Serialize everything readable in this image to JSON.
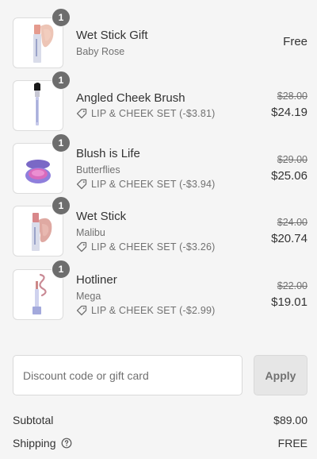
{
  "items": [
    {
      "quantity": "1",
      "name": "Wet Stick Gift",
      "variant": "Baby Rose",
      "discount": "",
      "original_price": "",
      "price": "Free",
      "image_icon": "lipstick-image"
    },
    {
      "quantity": "1",
      "name": "Angled Cheek Brush",
      "variant": "",
      "discount": "LIP & CHEEK SET (-$3.81)",
      "original_price": "$28.00",
      "price": "$24.19",
      "image_icon": "brush-image"
    },
    {
      "quantity": "1",
      "name": "Blush is Life",
      "variant": "Butterflies",
      "discount": "LIP & CHEEK SET (-$3.94)",
      "original_price": "$29.00",
      "price": "$25.06",
      "image_icon": "blush-compact-image"
    },
    {
      "quantity": "1",
      "name": "Wet Stick",
      "variant": "Malibu",
      "discount": "LIP & CHEEK SET (-$3.26)",
      "original_price": "$24.00",
      "price": "$20.74",
      "image_icon": "lipstick-image"
    },
    {
      "quantity": "1",
      "name": "Hotliner",
      "variant": "Mega",
      "discount": "LIP & CHEEK SET (-$2.99)",
      "original_price": "$22.00",
      "price": "$19.01",
      "image_icon": "lip-liner-image"
    }
  ],
  "discount_form": {
    "placeholder": "Discount code or gift card",
    "value": "",
    "apply_label": "Apply"
  },
  "summary": {
    "subtotal_label": "Subtotal",
    "subtotal_value": "$89.00",
    "shipping_label": "Shipping",
    "shipping_value": "FREE"
  },
  "colors": {
    "background": "#f5f5f5",
    "badge": "#6d6d6d",
    "muted_text": "#717171"
  }
}
